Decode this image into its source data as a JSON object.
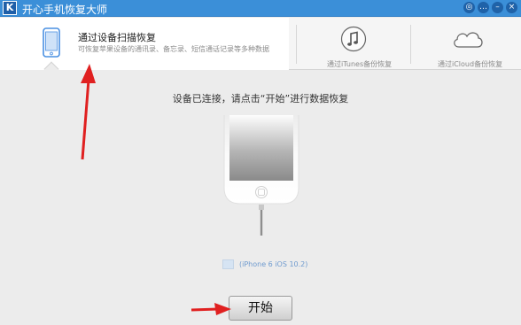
{
  "window": {
    "title": "开心手机恢复大师",
    "logo_text": "K",
    "controls": [
      {
        "name": "wechat-icon",
        "glyph": "◎"
      },
      {
        "name": "feedback-icon",
        "glyph": "…"
      },
      {
        "name": "minimize-icon",
        "glyph": "–"
      },
      {
        "name": "close-icon",
        "glyph": "×"
      }
    ]
  },
  "tabs": {
    "device_scan": {
      "title": "通过设备扫描恢复",
      "description": "可恢复苹果设备的通讯录、备忘录、短信通话记录等多种数据"
    },
    "itunes": {
      "label": "通过iTunes备份恢复"
    },
    "icloud": {
      "label": "通过iCloud备份恢复"
    }
  },
  "main": {
    "instruction": "设备已连接，请点击“开始”进行数据恢复",
    "device_name": "(iPhone 6 iOS 10.2)",
    "start_label": "开始"
  },
  "colors": {
    "titlebar": "#3b8fd8",
    "accent": "#4a90e2",
    "annotation_arrow": "#e02020"
  }
}
